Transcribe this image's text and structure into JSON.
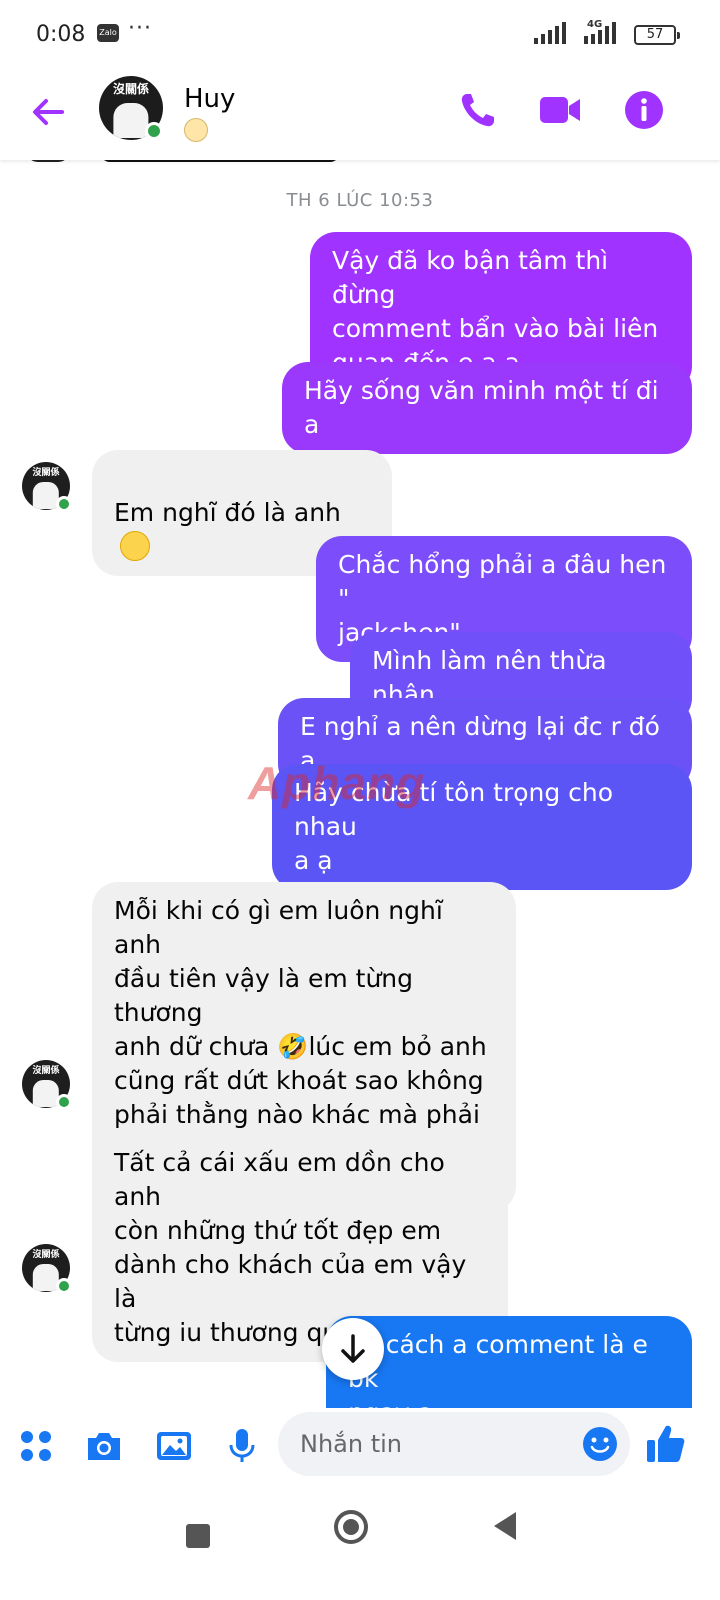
{
  "status_bar": {
    "time": "0:08",
    "app_badge": "Zalo",
    "more": "···",
    "network": "4G",
    "battery": "57"
  },
  "header": {
    "contact_name": "Huy",
    "avatar_text": "沒關係",
    "accent_color": "#a033ff"
  },
  "chat": {
    "timestamp": "TH 6 LÚC 10:53",
    "watermark": "Aphang",
    "messages": [
      {
        "side": "out",
        "text": "Vậy đã ko bận tâm thì đừng\ncomment bẩn vào bài liên\nquan đến e a ạ",
        "color": "#a033ff"
      },
      {
        "side": "out",
        "text": "Hãy sống văn minh một tí đi a",
        "color": "#9a38fb"
      },
      {
        "side": "in",
        "text": "Em nghĩ đó là anh"
      },
      {
        "side": "out",
        "text": "Chắc hổng phải a đâu hen \"\njackchen\"",
        "color": "#7c4dfa"
      },
      {
        "side": "out",
        "text": "Mình làm nên thừa nhận",
        "color": "#7050f8"
      },
      {
        "side": "out",
        "text": "E nghỉ a nên dừng lại đc r đó a",
        "color": "#6a52f7"
      },
      {
        "side": "out",
        "text": "Hãy chừa tí tôn trọng cho nhau\na ạ",
        "color": "#5b55f5"
      },
      {
        "side": "in",
        "text": "Mỗi khi có gì em luôn nghĩ anh\nđầu tiên vậy là em từng thương\nanh dữ chưa 🤣lúc em bỏ anh\ncũng rất dứt khoát sao không\nphải thằng nào khác mà phải\nnhất thiết là anh vậy hả em 😆"
      },
      {
        "side": "in",
        "text": "Tất cả cái xấu em dồn cho anh\ncòn những thứ tốt đẹp em\ndành cho khách của em vậy là\ntừng iu thương quá hả em"
      },
      {
        "side": "out",
        "text": "Tk cách a comment là e bk\nngay a",
        "color": "#1877f2"
      }
    ]
  },
  "composer": {
    "placeholder": "Nhắn tin"
  }
}
